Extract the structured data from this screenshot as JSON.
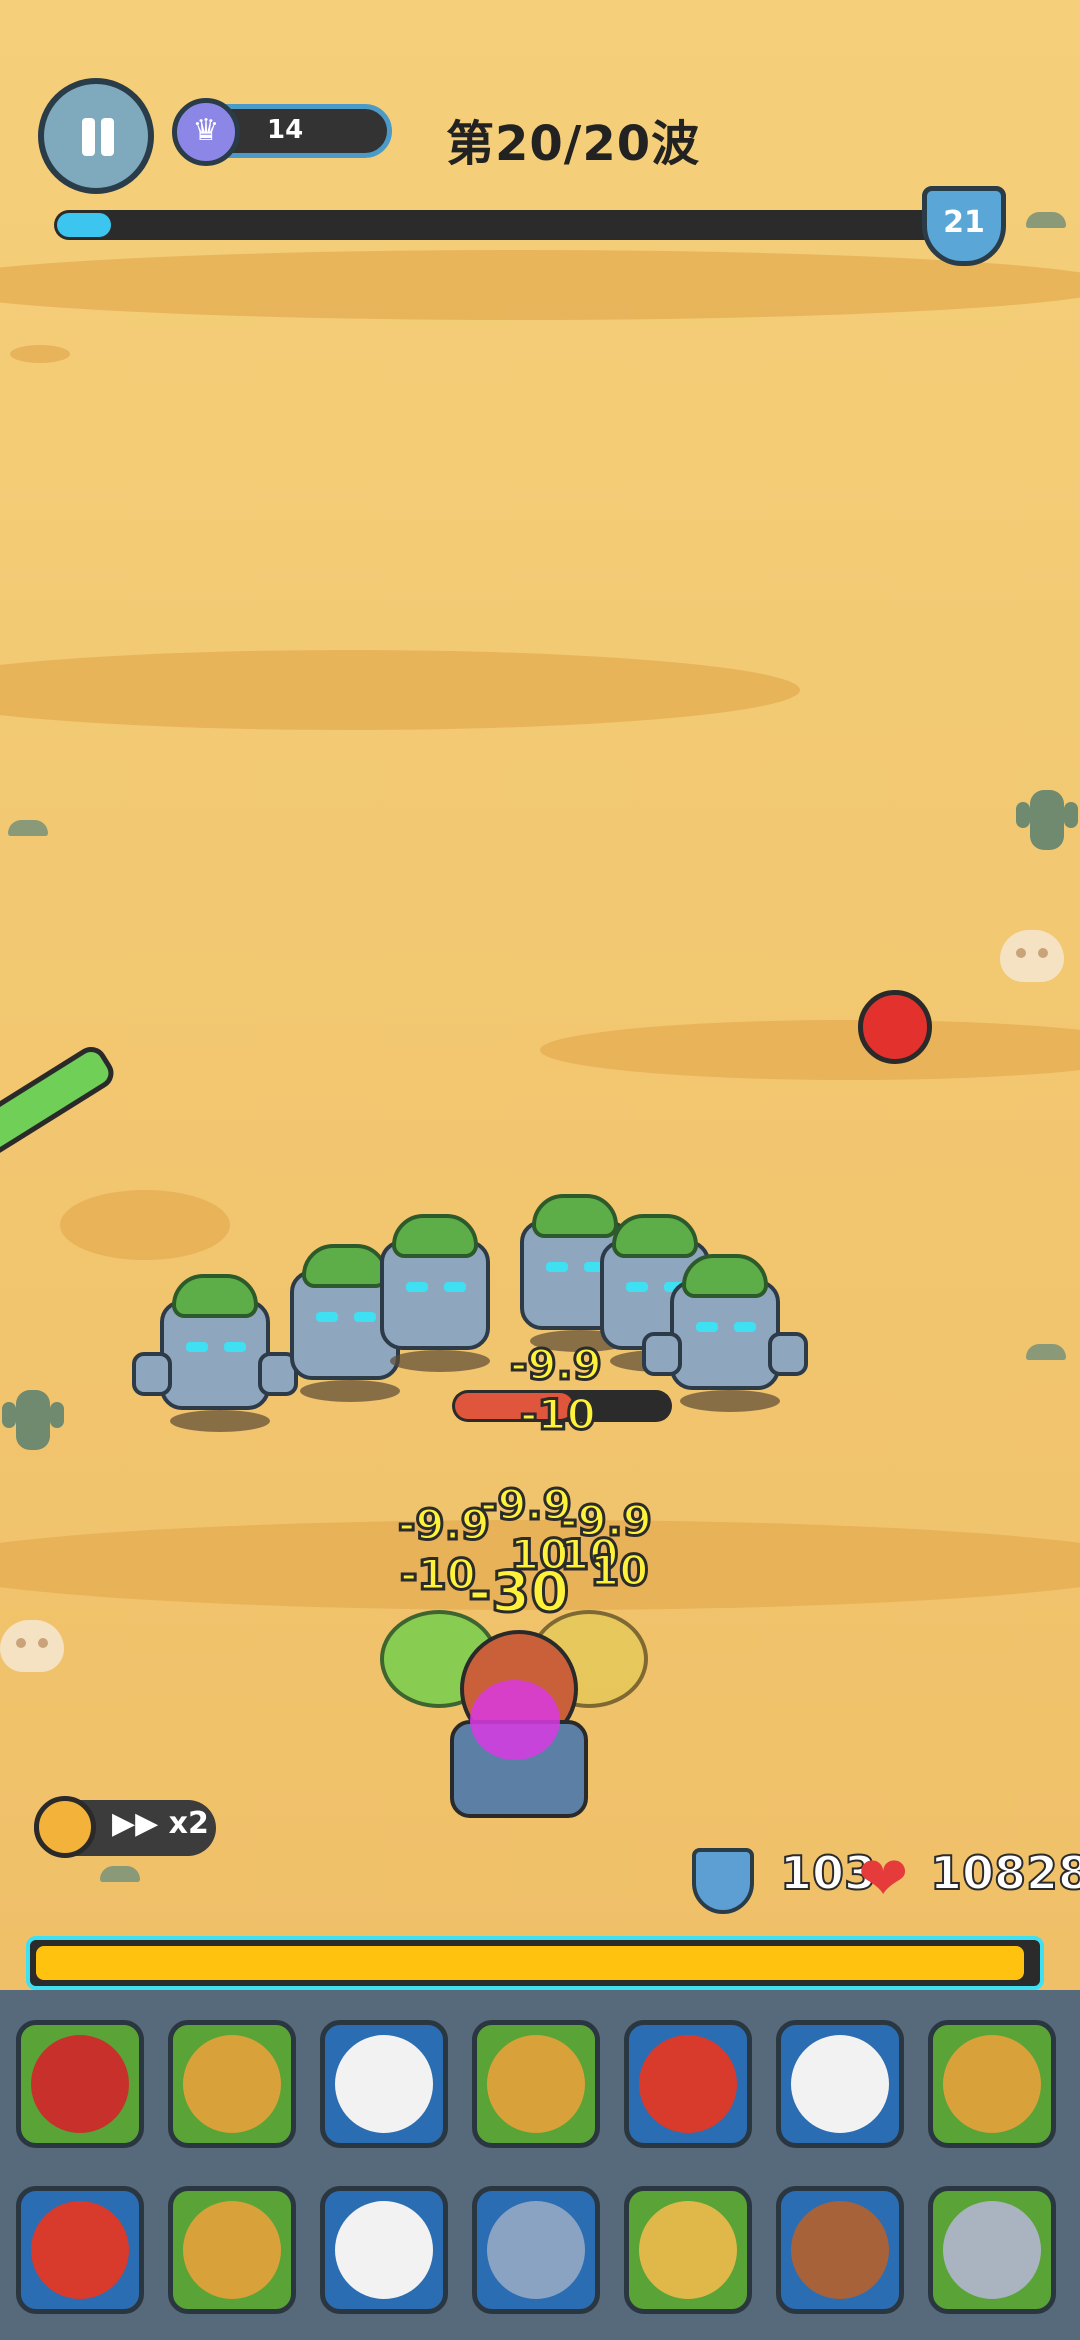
{
  "hud": {
    "crown_count": "14",
    "wave_label": "第20/20波",
    "level_badge": "21",
    "wave_progress": 0.06
  },
  "battle": {
    "damage_numbers": [
      "-9.9",
      "-10",
      "-9.9",
      "-9.9",
      "-9.9",
      "-10",
      "10",
      "10",
      "10",
      "-30"
    ],
    "enemy_health_fraction": 0.55
  },
  "controls": {
    "speed_label": "x2"
  },
  "player": {
    "shield": "103",
    "health": "10828",
    "xp_progress": 0.99
  },
  "inventory": {
    "items": [
      {
        "icon": "potion-icon",
        "frame": "green"
      },
      {
        "icon": "gold-armor-icon",
        "frame": "green"
      },
      {
        "icon": "round-shield-icon",
        "frame": "blue"
      },
      {
        "icon": "gold-armor-icon",
        "frame": "green"
      },
      {
        "icon": "robe-icon",
        "frame": "blue"
      },
      {
        "icon": "round-shield-icon",
        "frame": "blue"
      },
      {
        "icon": "gold-armor-icon",
        "frame": "green"
      },
      {
        "icon": "robe-icon",
        "frame": "blue"
      },
      {
        "icon": "gold-armor-icon",
        "frame": "green"
      },
      {
        "icon": "round-shield-icon",
        "frame": "blue"
      },
      {
        "icon": "steel-shield-icon",
        "frame": "blue"
      },
      {
        "icon": "ring-icon",
        "frame": "green"
      },
      {
        "icon": "wooden-shield-icon",
        "frame": "blue"
      },
      {
        "icon": "silver-ring-icon",
        "frame": "green"
      }
    ]
  }
}
